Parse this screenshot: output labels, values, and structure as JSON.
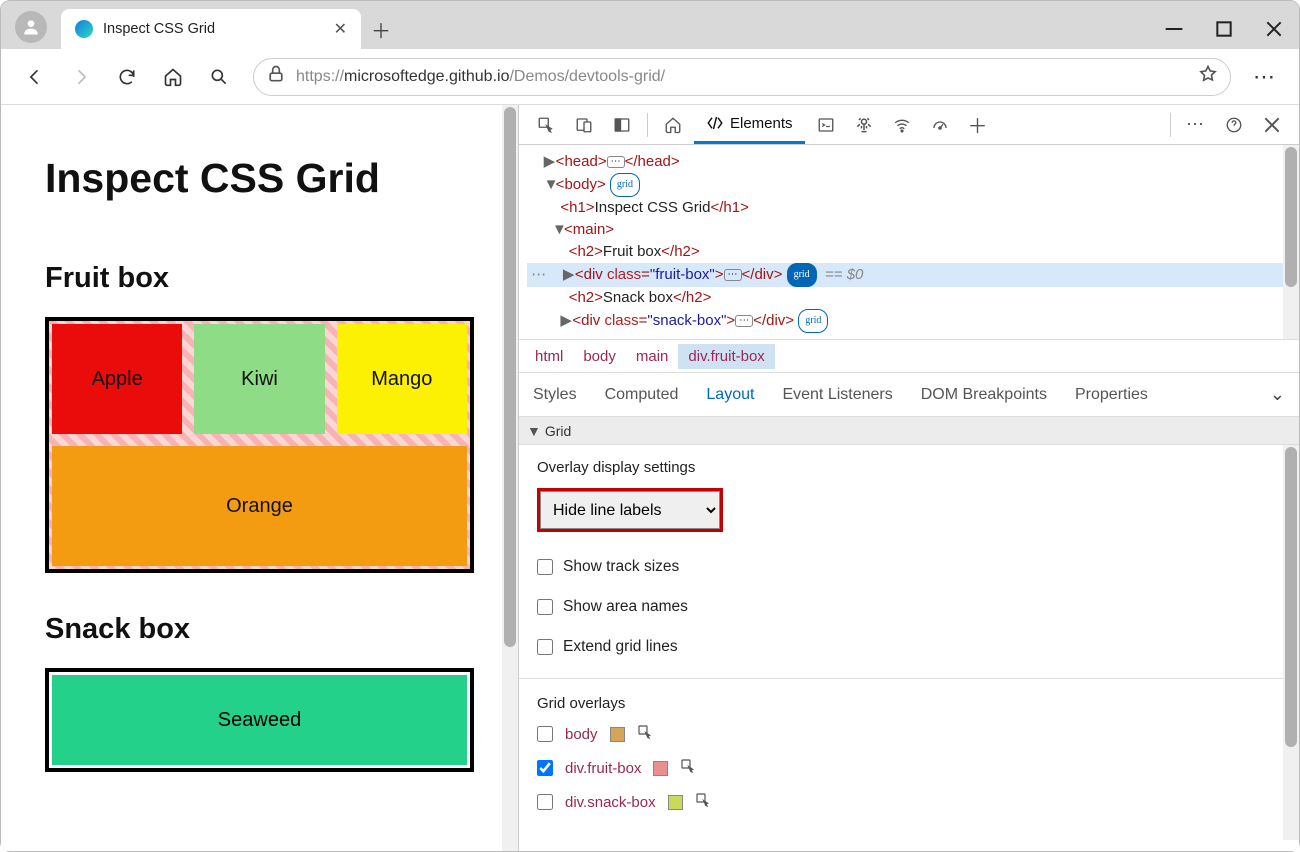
{
  "tab": {
    "title": "Inspect CSS Grid"
  },
  "url": {
    "protocol": "https://",
    "host": "microsoftedge.github.io",
    "path": "/Demos/devtools-grid/"
  },
  "page": {
    "h1": "Inspect CSS Grid",
    "h2_fruit": "Fruit box",
    "h2_snack": "Snack box",
    "fruits": {
      "apple": "Apple",
      "kiwi": "Kiwi",
      "mango": "Mango",
      "orange": "Orange"
    },
    "snacks": {
      "seaweed": "Seaweed"
    }
  },
  "devtools": {
    "tab_elements": "Elements",
    "dom": {
      "head": "head",
      "body": "body",
      "grid": "grid",
      "h1_open": "<h1>",
      "h1_txt": "Inspect CSS Grid",
      "h1_close": "</h1>",
      "main": "main",
      "h2a_open": "<h2>",
      "h2a_txt": "Fruit box",
      "h2a_close": "</h2>",
      "div_open": "<div ",
      "class_attr": "class",
      "fruit_val": "\"fruit-box\"",
      "div_close_gt": ">",
      "div_close": "</div>",
      "sel": "== $0",
      "h2b_open": "<h2>",
      "h2b_txt": "Snack box",
      "h2b_close": "</h2>",
      "snack_val": "\"snack-box\""
    },
    "breadcrumb": [
      "html",
      "body",
      "main",
      "div.fruit-box"
    ],
    "subtabs": {
      "styles": "Styles",
      "computed": "Computed",
      "layout": "Layout",
      "events": "Event Listeners",
      "dom": "DOM Breakpoints",
      "props": "Properties"
    },
    "grid_header": "Grid",
    "overlay_title": "Overlay display settings",
    "dropdown": "Hide line labels",
    "cb1": "Show track sizes",
    "cb2": "Show area names",
    "cb3": "Extend grid lines",
    "overlays_title": "Grid overlays",
    "ov": [
      {
        "name": "body",
        "checked": false,
        "color": "#d6a55a"
      },
      {
        "name": "div.fruit-box",
        "checked": true,
        "color": "#e88f8f"
      },
      {
        "name": "div.snack-box",
        "checked": false,
        "color": "#c9d95a"
      }
    ]
  }
}
